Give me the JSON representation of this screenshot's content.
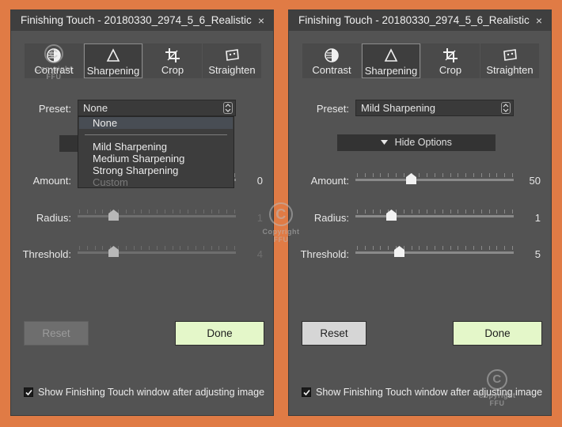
{
  "colors": {
    "background": "#e07b45",
    "panel": "#535353",
    "titlebar": "#3f3f3f",
    "done_button": "#e4f7c9",
    "reset_button": "#d6d6d6"
  },
  "icons": {
    "contrast": "contrast-icon",
    "sharpening": "triangle-icon",
    "crop": "crop-icon",
    "straighten": "straighten-icon",
    "close": "close-icon",
    "stepper": "up-down-stepper-icon",
    "chevron": "chevron-down-icon",
    "checkmark": "checkmark-icon"
  },
  "watermark": {
    "symbol": "C",
    "line1": "Copyright",
    "line2": "FFU"
  },
  "left_panel": {
    "title": "Finishing Touch - 20180330_2974_5_6_Realistic",
    "close": "×",
    "tabs": [
      {
        "label": "Contrast",
        "active": false
      },
      {
        "label": "Sharpening",
        "active": true
      },
      {
        "label": "Crop",
        "active": false
      },
      {
        "label": "Straighten",
        "active": false
      }
    ],
    "preset_label": "Preset:",
    "preset_value": "None",
    "dropdown": {
      "items": [
        {
          "label": "None",
          "selected": true,
          "disabled": false
        },
        {
          "label": "Mild Sharpening",
          "selected": false,
          "disabled": false
        },
        {
          "label": "Medium Sharpening",
          "selected": false,
          "disabled": false
        },
        {
          "label": "Strong Sharpening",
          "selected": false,
          "disabled": false
        },
        {
          "label": "Custom",
          "selected": false,
          "disabled": true
        }
      ]
    },
    "sliders": [
      {
        "label": "Amount:",
        "value": "0",
        "level": 0,
        "dimmed": false
      },
      {
        "label": "Radius:",
        "value": "1",
        "level": 0.21,
        "dimmed": true
      },
      {
        "label": "Threshold:",
        "value": "4",
        "level": 0.21,
        "dimmed": true
      }
    ],
    "reset_label": "Reset",
    "done_label": "Done",
    "checkbox_label": "Show Finishing Touch window after adjusting image"
  },
  "right_panel": {
    "title": "Finishing Touch - 20180330_2974_5_6_Realistic",
    "close": "×",
    "tabs": [
      {
        "label": "Contrast",
        "active": false
      },
      {
        "label": "Sharpening",
        "active": true
      },
      {
        "label": "Crop",
        "active": false
      },
      {
        "label": "Straighten",
        "active": false
      }
    ],
    "preset_label": "Preset:",
    "preset_value": "Mild Sharpening",
    "hide_options_label": "Hide Options",
    "sliders": [
      {
        "label": "Amount:",
        "value": "50",
        "level": 0.34,
        "dimmed": false
      },
      {
        "label": "Radius:",
        "value": "1",
        "level": 0.21,
        "dimmed": false
      },
      {
        "label": "Threshold:",
        "value": "5",
        "level": 0.26,
        "dimmed": false
      }
    ],
    "reset_label": "Reset",
    "done_label": "Done",
    "checkbox_label": "Show Finishing Touch window after adjusting image"
  }
}
